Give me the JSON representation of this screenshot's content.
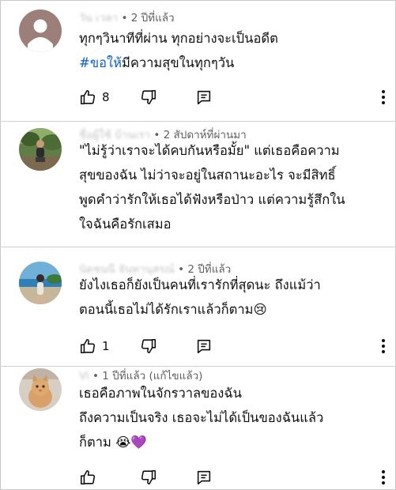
{
  "comments": [
    {
      "author": "วัน เวลา",
      "time": "2 ปีที่แล้ว",
      "lines": [
        {
          "text": "ทุกๆวินาทีที่ผ่าน ทุกอย่างจะเป็นอดีต"
        },
        {
          "hashtag": "#ขอให้",
          "text": "มีความสุขในทุกๆวัน"
        }
      ],
      "likes": "8"
    },
    {
      "author": "ชื่อผู้ใช้ บ้านเรา",
      "time": "2 สัปดาห์ที่ผ่านมา",
      "lines": [
        {
          "text": "\"ไม่รู้ว่าเราจะได้คบกันหรือมั้ย\" แต่เธอคือความ"
        },
        {
          "text": "สุขของฉัน ไม่ว่าจะอยู่ในสถานะอะไร จะมีสิทธิ์"
        },
        {
          "text": "พูดคำว่ารักให้เธอได้ฟังหรือป่าว แต่ความรู้สึกใน"
        },
        {
          "text": "ใจฉันคือรักเสมอ"
        }
      ],
      "likes": ""
    },
    {
      "author": "นัดชนนี จันทานุสรณ์",
      "time": "2 ปีที่แล้ว",
      "lines": [
        {
          "text": "ยังไงเธอก็ยังเป็นคนที่เรารักที่สุดนะ ถึงแม้ว่า"
        },
        {
          "text": "ตอนนี้เธอไม่ได้รักเราแล้วก็ตาม😢"
        }
      ],
      "likes": "1"
    },
    {
      "author": "Vi",
      "time": "1 ปีที่แล้ว (แก้ไขแล้ว)",
      "lines": [
        {
          "text": "เธอคือภาพในจักรวาลของฉัน"
        },
        {
          "text": "ถึงความเป็นจริง เธอจะไม่ได้เป็นของฉันแล้ว"
        },
        {
          "text": "ก็ตาม 😭💜"
        }
      ],
      "likes": ""
    }
  ],
  "icons": {
    "like": "thumb-up-icon",
    "dislike": "thumb-down-icon",
    "reply": "reply-icon",
    "more": "more-vert-icon"
  },
  "colors": {
    "hashtag": "#065fd4",
    "meta": "#606060",
    "text": "#0f0f0f"
  }
}
